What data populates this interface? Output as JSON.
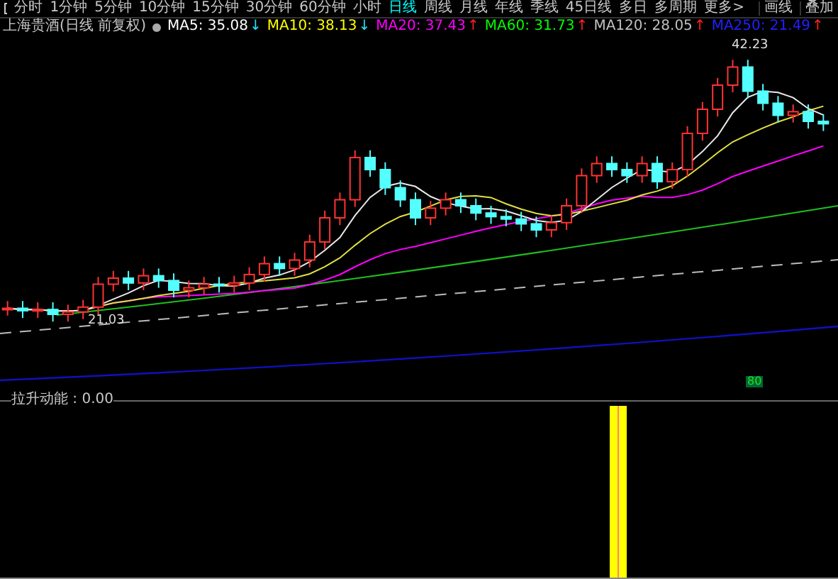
{
  "toolbar": {
    "tabs": [
      {
        "label": "分时",
        "selected": false
      },
      {
        "label": "1分钟",
        "selected": false
      },
      {
        "label": "5分钟",
        "selected": false
      },
      {
        "label": "10分钟",
        "selected": false
      },
      {
        "label": "15分钟",
        "selected": false
      },
      {
        "label": "30分钟",
        "selected": false
      },
      {
        "label": "60分钟",
        "selected": false
      },
      {
        "label": "小时",
        "selected": false
      },
      {
        "label": "日线",
        "selected": true
      },
      {
        "label": "周线",
        "selected": false
      },
      {
        "label": "月线",
        "selected": false
      },
      {
        "label": "年线",
        "selected": false
      },
      {
        "label": "季线",
        "selected": false
      },
      {
        "label": "45日线",
        "selected": false
      },
      {
        "label": "多日",
        "selected": false
      },
      {
        "label": "多周期",
        "selected": false
      },
      {
        "label": "更多>",
        "selected": false
      }
    ],
    "right_buttons": [
      "画线",
      "叠加"
    ]
  },
  "chart_header": {
    "title": "上海贵酒(日线 前复权)",
    "indicators": [
      {
        "text": "MA5: 35.08",
        "color": "#ffffff",
        "arrow": {
          "text": "↓",
          "color": "#20e0ff"
        }
      },
      {
        "text": "MA10: 38.13",
        "color": "#ffff00",
        "arrow": {
          "text": "↓",
          "color": "#20e0ff"
        }
      },
      {
        "text": "MA20: 37.43",
        "color": "#ff00ff",
        "arrow": {
          "text": "↑",
          "color": "#ff2020"
        }
      },
      {
        "text": "MA60: 31.73",
        "color": "#00ff00",
        "arrow": {
          "text": "↑",
          "color": "#ff2020"
        }
      },
      {
        "text": "MA120: 28.05",
        "color": "#c0c0c0",
        "arrow": {
          "text": "↑",
          "color": "#ff2020"
        }
      },
      {
        "text": "MA250: 21.49",
        "color": "#2020ff",
        "arrow": {
          "text": "↑",
          "color": "#ff2020"
        }
      }
    ]
  },
  "price_labels": [
    {
      "text": "42.23"
    },
    {
      "text": "21.03"
    }
  ],
  "volume_label": "80",
  "indicator_panel": {
    "label": "拉升动能 : 0.00"
  }
}
